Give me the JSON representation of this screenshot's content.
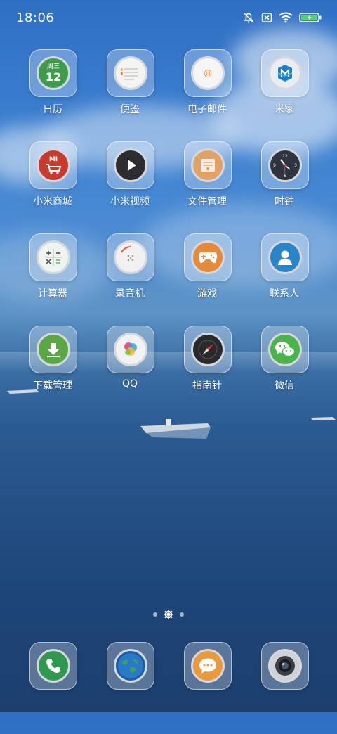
{
  "status_bar": {
    "time": "18:06"
  },
  "apps": [
    {
      "label": "日历",
      "icon": "calendar-icon",
      "day_text": "周三",
      "date_num": "12"
    },
    {
      "label": "便签",
      "icon": "notes-icon"
    },
    {
      "label": "电子邮件",
      "icon": "email-icon"
    },
    {
      "label": "米家",
      "icon": "mijia-icon"
    },
    {
      "label": "小米商城",
      "icon": "mi-store-icon",
      "brand_text": "MI"
    },
    {
      "label": "小米视频",
      "icon": "video-icon"
    },
    {
      "label": "文件管理",
      "icon": "file-manager-icon"
    },
    {
      "label": "时钟",
      "icon": "clock-icon"
    },
    {
      "label": "计算器",
      "icon": "calculator-icon"
    },
    {
      "label": "录音机",
      "icon": "recorder-icon"
    },
    {
      "label": "游戏",
      "icon": "game-icon"
    },
    {
      "label": "联系人",
      "icon": "contacts-icon"
    },
    {
      "label": "下载管理",
      "icon": "download-icon"
    },
    {
      "label": "QQ",
      "icon": "qq-icon"
    },
    {
      "label": "指南针",
      "icon": "compass-icon"
    },
    {
      "label": "微信",
      "icon": "wechat-icon"
    }
  ],
  "page_indicator": {
    "pages": 3,
    "current": 2
  },
  "dock": [
    {
      "icon": "phone-icon"
    },
    {
      "icon": "browser-icon"
    },
    {
      "icon": "messages-icon"
    },
    {
      "icon": "camera-icon"
    }
  ]
}
